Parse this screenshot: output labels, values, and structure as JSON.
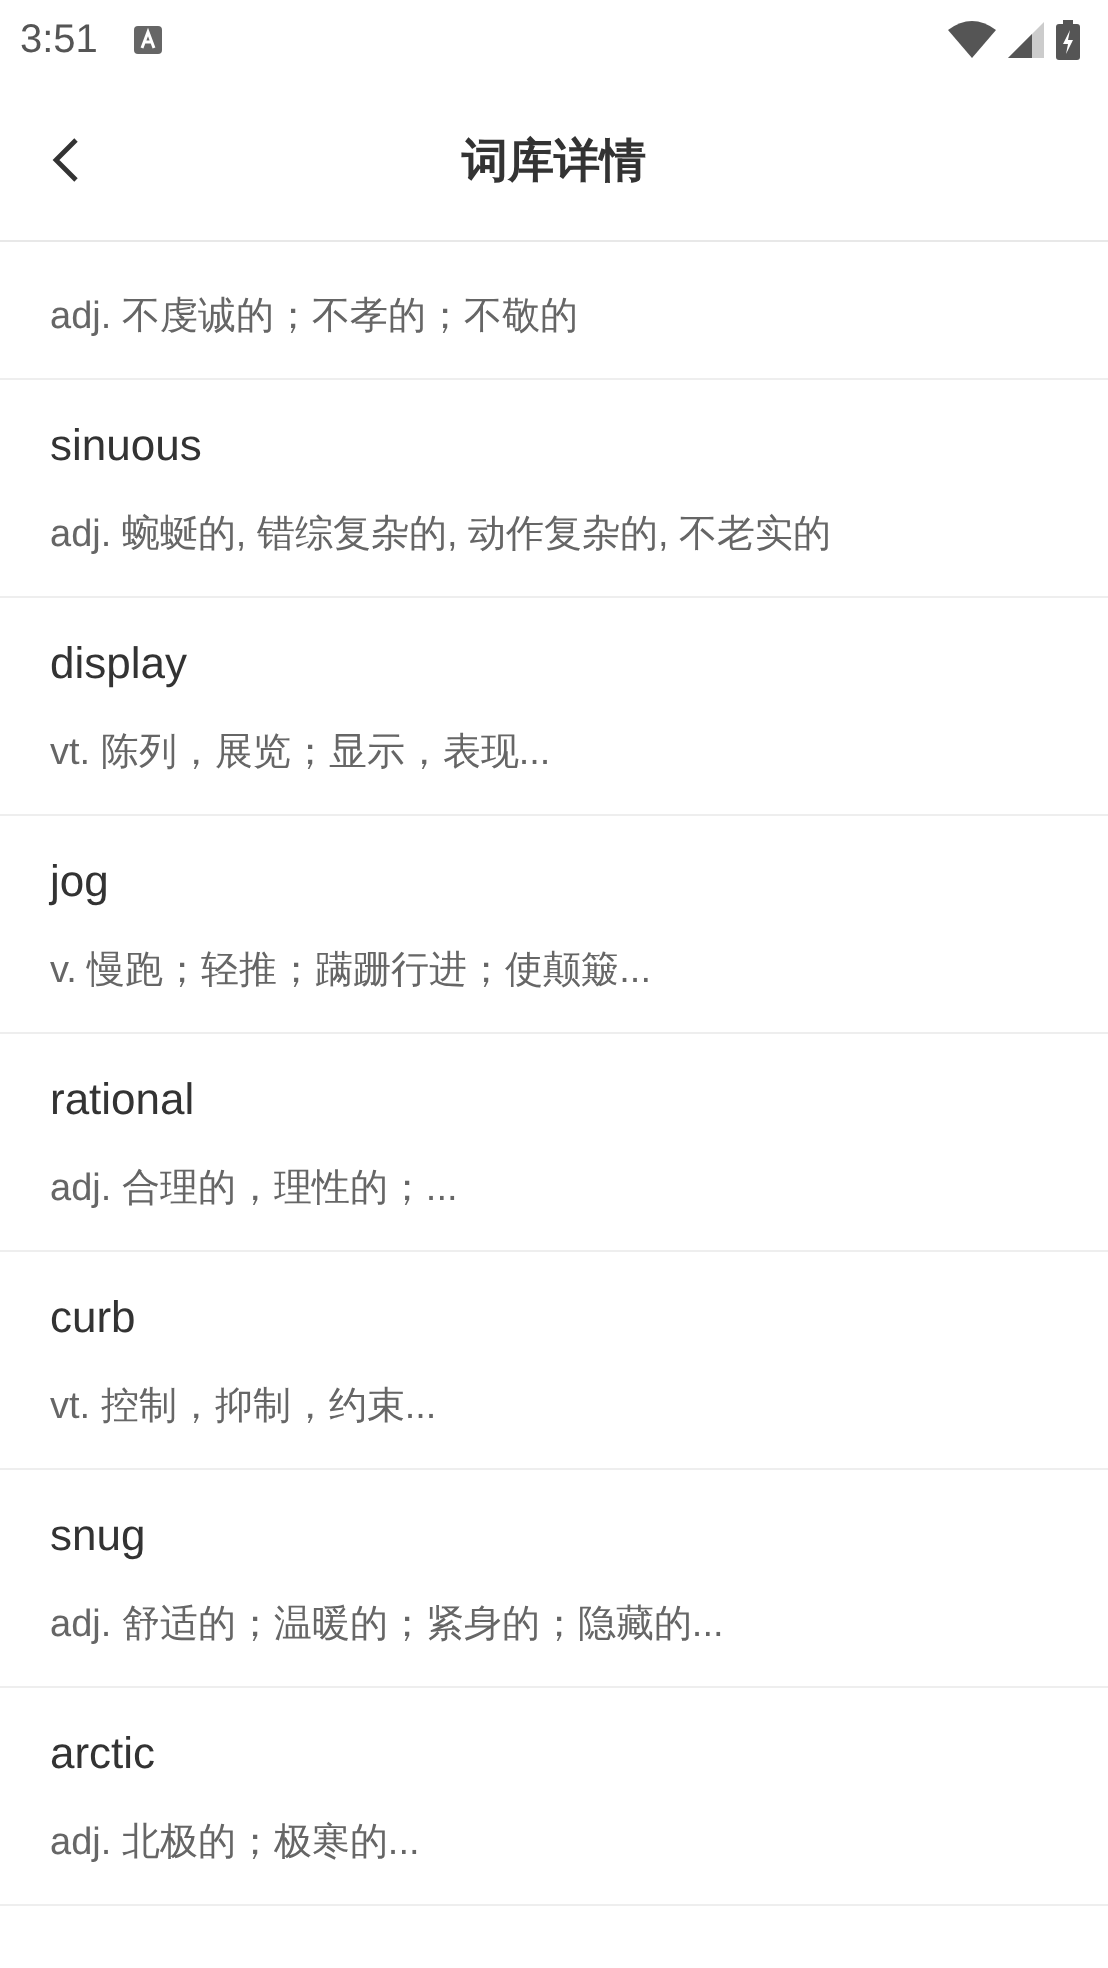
{
  "status_bar": {
    "time": "3:51"
  },
  "header": {
    "title": "词库详情"
  },
  "words": [
    {
      "definition": "adj. 不虔诚的；不孝的；不敬的"
    },
    {
      "word": "sinuous",
      "definition": "adj. 蜿蜒的, 错综复杂的, 动作复杂的, 不老实的"
    },
    {
      "word": "display",
      "definition": "vt. 陈列，展览；显示，表现..."
    },
    {
      "word": "jog",
      "definition": "v. 慢跑；轻推；蹒跚行进；使颠簸..."
    },
    {
      "word": "rational",
      "definition": "adj. 合理的，理性的；..."
    },
    {
      "word": "curb",
      "definition": "vt. 控制，抑制，约束..."
    },
    {
      "word": "snug",
      "definition": "adj. 舒适的；温暖的；紧身的；隐藏的..."
    },
    {
      "word": "arctic",
      "definition": "adj. 北极的；极寒的..."
    }
  ]
}
